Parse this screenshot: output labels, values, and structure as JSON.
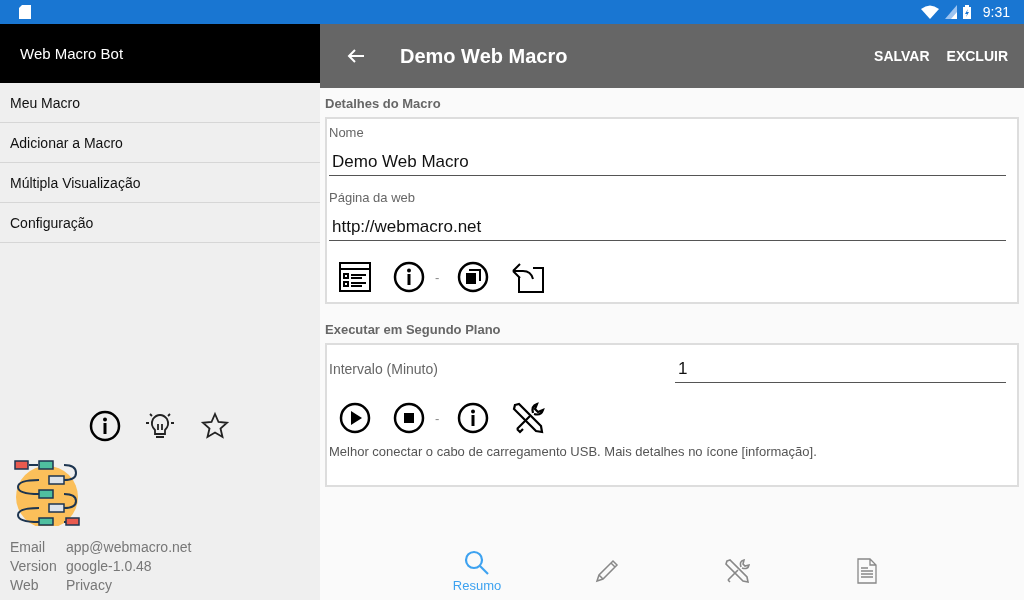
{
  "status_bar": {
    "time": "9:31"
  },
  "drawer": {
    "title": "Web Macro Bot",
    "items": [
      {
        "label": "Meu Macro"
      },
      {
        "label": "Adicionar a Macro"
      },
      {
        "label": "Múltipla Visualização"
      },
      {
        "label": "Configuração"
      }
    ],
    "info": [
      {
        "key": "Email",
        "value": "app@webmacro.net"
      },
      {
        "key": "Version",
        "value": "google-1.0.48"
      },
      {
        "key": "Web",
        "value": "Privacy"
      }
    ]
  },
  "toolbar": {
    "title": "Demo Web Macro",
    "actions": [
      "SALVAR",
      "EXCLUIR"
    ]
  },
  "details": {
    "heading": "Detalhes do Macro",
    "name_label": "Nome",
    "name_value": "Demo Web Macro",
    "page_label": "Página da web",
    "page_value": "http://webmacro.net",
    "separator": "-"
  },
  "background": {
    "heading": "Executar em Segundo Plano",
    "interval_label": "Intervalo (Minuto)",
    "interval_value": "1",
    "separator": "-",
    "note": "Melhor conectar o cabo de carregamento USB. Mais detalhes no ícone [informação]."
  },
  "bottom_nav": [
    {
      "kind": "search",
      "label": "Resumo",
      "selected": true
    },
    {
      "kind": "pencil",
      "selected": false
    },
    {
      "kind": "tools",
      "selected": false
    },
    {
      "kind": "document",
      "selected": false
    }
  ]
}
